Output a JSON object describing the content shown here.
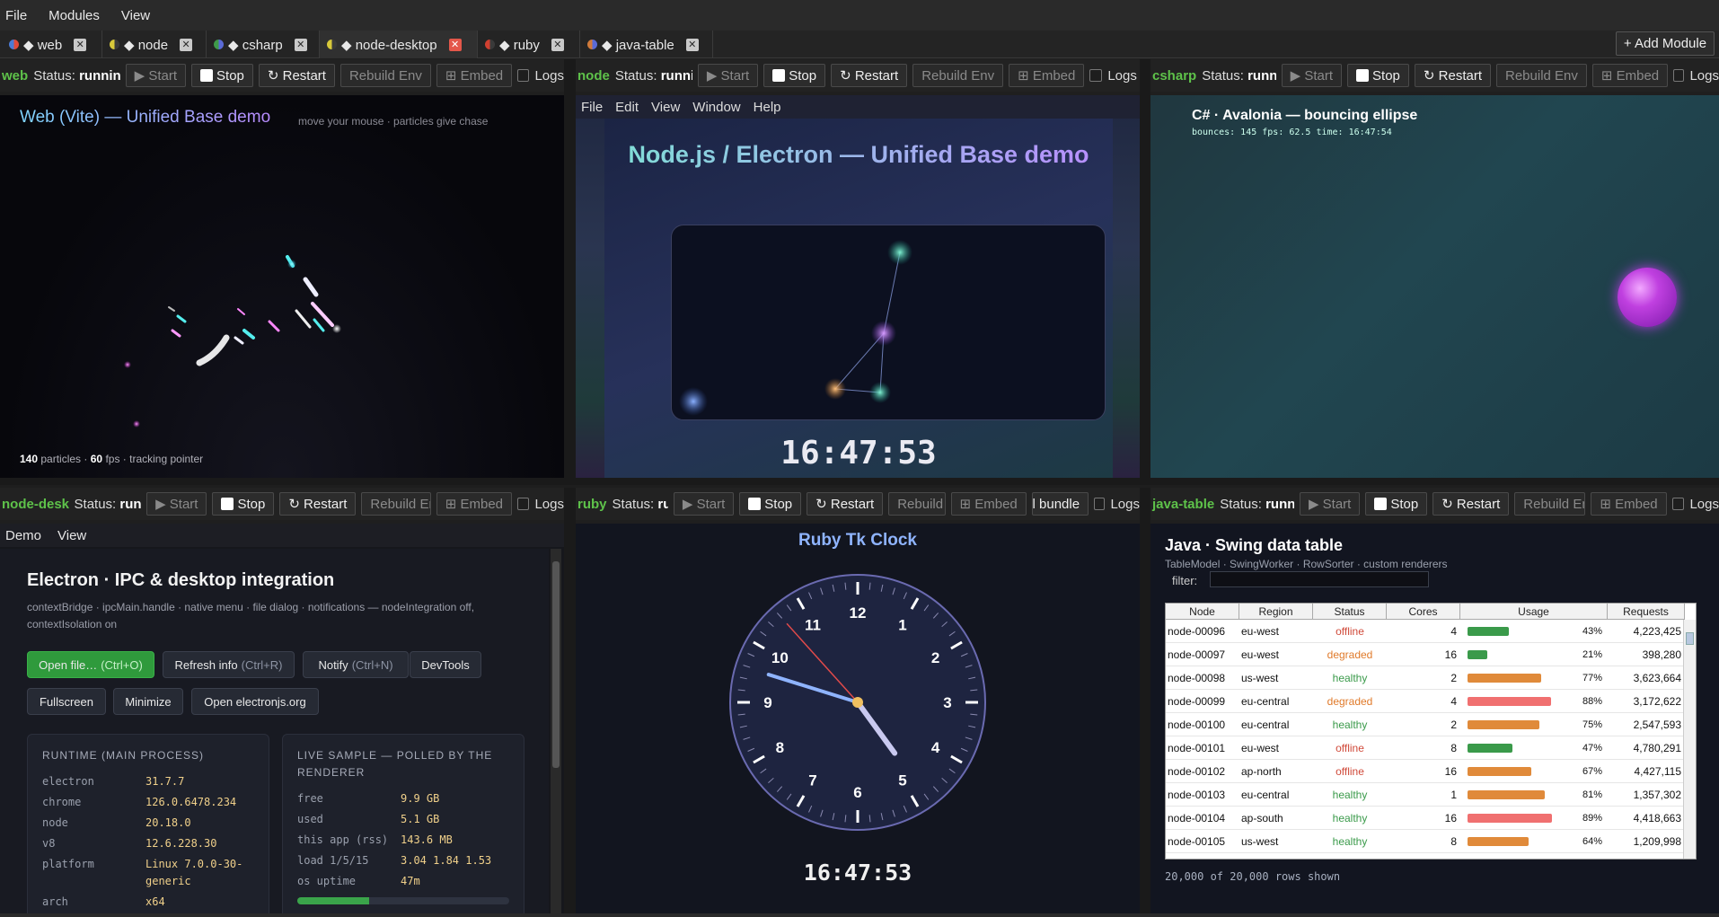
{
  "menubar": {
    "items": [
      "File",
      "Modules",
      "View"
    ]
  },
  "tabs": [
    {
      "label": "◆ web",
      "c1": "#4b7bd6",
      "c2": "#e04a3c"
    },
    {
      "label": "◆ node",
      "c1": "#d8c93a",
      "c2": "#3a3a3a"
    },
    {
      "label": "◆ csharp",
      "c1": "#3f9a4a",
      "c2": "#5a6ad6"
    },
    {
      "label": "◆ node-desktop",
      "c1": "#d8c93a",
      "c2": "#3a3a3a"
    },
    {
      "label": "◆ ruby",
      "c1": "#d04030",
      "c2": "#3a3a3a"
    },
    {
      "label": "◆ java-table",
      "c1": "#d07a3a",
      "c2": "#5a6ad6"
    }
  ],
  "add_module": "+ Add Module",
  "controls": {
    "status_label": "Status:",
    "start": "▶ Start",
    "stop": "Stop",
    "restart": "↻ Restart",
    "rebuild": "Rebuild Env",
    "embed": "⊞ Embed",
    "logs": "Logs",
    "install": "Install bundle"
  },
  "panes": {
    "web": {
      "name": "web",
      "status": "running"
    },
    "node": {
      "name": "node",
      "status": "running"
    },
    "csharp": {
      "name": "csharp",
      "status": "running"
    },
    "node_desktop": {
      "name": "node-desktop",
      "status": "running"
    },
    "ruby": {
      "name": "ruby",
      "status": "running"
    },
    "java": {
      "name": "java-table",
      "status": "running"
    }
  },
  "web_demo": {
    "title": "Web (Vite) — Unified Base demo",
    "hint": "move your mouse · particles give chase",
    "particles": "140",
    "particles_label": "particles",
    "fps": "60",
    "fps_label": "fps",
    "mode": "tracking pointer"
  },
  "node_demo": {
    "menu": [
      "File",
      "Edit",
      "View",
      "Window",
      "Help"
    ],
    "title": "Node.js / Electron — Unified Base demo",
    "clock": "16:47:53"
  },
  "csharp_demo": {
    "title": "C# · Avalonia — bouncing ellipse",
    "stats": "bounces: 145   fps:  62.5  time: 16:47:54"
  },
  "electron_demo": {
    "menu": [
      "Demo",
      "View"
    ],
    "title": "Electron · IPC & desktop integration",
    "subtitle": "contextBridge · ipcMain.handle · native menu · file dialog · notifications — nodeIntegration off, contextIsolation on",
    "buttons": [
      {
        "label": "Open file…",
        "shortcut": "(Ctrl+O)"
      },
      {
        "label": "Refresh info",
        "shortcut": "(Ctrl+R)"
      },
      {
        "label": "Notify",
        "shortcut": "(Ctrl+N)"
      },
      {
        "label": "DevTools",
        "shortcut": ""
      },
      {
        "label": "Fullscreen",
        "shortcut": ""
      },
      {
        "label": "Minimize",
        "shortcut": ""
      },
      {
        "label": "Open electronjs.org",
        "shortcut": ""
      }
    ],
    "runtime": {
      "title": "RUNTIME (MAIN PROCESS)",
      "rows": [
        {
          "k": "electron",
          "v": "31.7.7"
        },
        {
          "k": "chrome",
          "v": "126.0.6478.234"
        },
        {
          "k": "node",
          "v": "20.18.0"
        },
        {
          "k": "v8",
          "v": "12.6.228.30"
        },
        {
          "k": "platform",
          "v": "Linux 7.0.0-30-generic"
        },
        {
          "k": "arch",
          "v": "x64"
        }
      ]
    },
    "live": {
      "title": "LIVE SAMPLE — POLLED BY THE RENDERER",
      "rows": [
        {
          "k": "free",
          "v": "9.9 GB"
        },
        {
          "k": "used",
          "v": "5.1 GB"
        },
        {
          "k": "this app (rss)",
          "v": "143.6 MB"
        },
        {
          "k": "load 1/5/15",
          "v": "3.04 1.84 1.53"
        },
        {
          "k": "os uptime",
          "v": "47m"
        }
      ],
      "mem_used_fraction": 0.34
    }
  },
  "ruby_demo": {
    "title": "Ruby Tk Clock",
    "digital": "16:47:53",
    "hour_labels": [
      "12",
      "1",
      "2",
      "3",
      "4",
      "5",
      "6",
      "7",
      "8",
      "9",
      "10",
      "11"
    ],
    "time": {
      "h": 16,
      "m": 47,
      "s": 53
    }
  },
  "java_demo": {
    "title": "Java · Swing data table",
    "subtitle": "TableModel · SwingWorker · RowSorter · custom renderers",
    "filter_label": "filter:",
    "filter_value": "",
    "columns": [
      "Node",
      "Region",
      "Status",
      "Cores",
      "Usage",
      "Requests"
    ],
    "rows": [
      {
        "node": "node-00096",
        "region": "eu-west",
        "status": "offline",
        "cores": "4",
        "usage": 43,
        "usage_label": "43%",
        "requests": "4,223,425"
      },
      {
        "node": "node-00097",
        "region": "eu-west",
        "status": "degraded",
        "cores": "16",
        "usage": 21,
        "usage_label": "21%",
        "requests": "398,280"
      },
      {
        "node": "node-00098",
        "region": "us-west",
        "status": "healthy",
        "cores": "2",
        "usage": 77,
        "usage_label": "77%",
        "requests": "3,623,664"
      },
      {
        "node": "node-00099",
        "region": "eu-central",
        "status": "degraded",
        "cores": "4",
        "usage": 88,
        "usage_label": "88%",
        "requests": "3,172,622"
      },
      {
        "node": "node-00100",
        "region": "eu-central",
        "status": "healthy",
        "cores": "2",
        "usage": 75,
        "usage_label": "75%",
        "requests": "2,547,593"
      },
      {
        "node": "node-00101",
        "region": "eu-west",
        "status": "offline",
        "cores": "8",
        "usage": 47,
        "usage_label": "47%",
        "requests": "4,780,291"
      },
      {
        "node": "node-00102",
        "region": "ap-north",
        "status": "offline",
        "cores": "16",
        "usage": 67,
        "usage_label": "67%",
        "requests": "4,427,115"
      },
      {
        "node": "node-00103",
        "region": "eu-central",
        "status": "healthy",
        "cores": "1",
        "usage": 81,
        "usage_label": "81%",
        "requests": "1,357,302"
      },
      {
        "node": "node-00104",
        "region": "ap-south",
        "status": "healthy",
        "cores": "16",
        "usage": 89,
        "usage_label": "89%",
        "requests": "4,418,663"
      },
      {
        "node": "node-00105",
        "region": "us-west",
        "status": "healthy",
        "cores": "8",
        "usage": 64,
        "usage_label": "64%",
        "requests": "1,209,998"
      }
    ],
    "footer": "20,000 of 20,000 rows shown",
    "status_colors": {
      "healthy": "#3a9a4a",
      "degraded": "#e07a2a",
      "offline": "#d04a3a"
    }
  }
}
